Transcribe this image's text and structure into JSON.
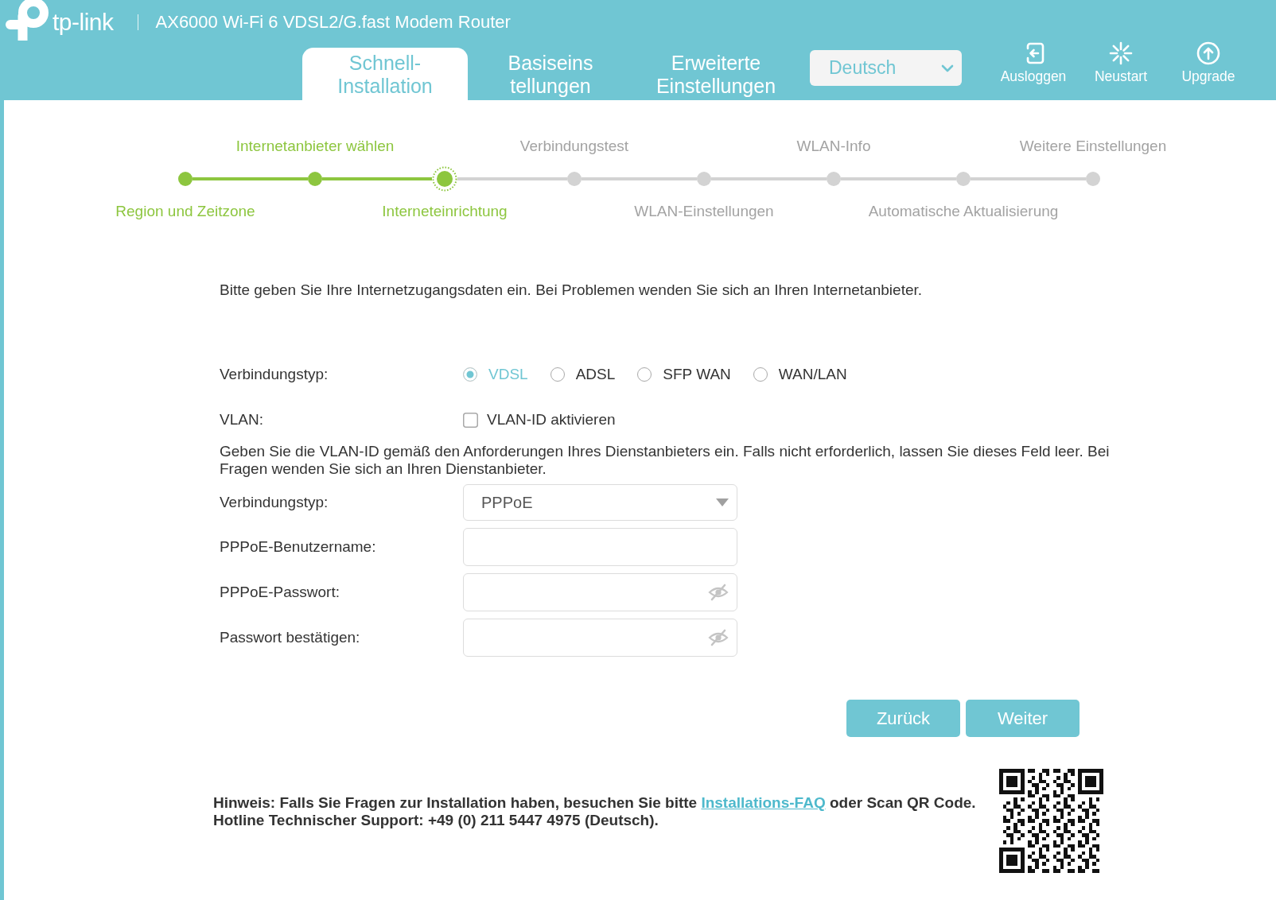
{
  "header": {
    "logo": "tp-link",
    "title": "AX6000 Wi-Fi 6 VDSL2/G.fast Modem Router",
    "tabs": [
      {
        "label": "Schnell-Installation",
        "selected": true
      },
      {
        "label": "Basiseins tellungen",
        "selected": false
      },
      {
        "label": "Erweiterte Einstellungen",
        "selected": false
      }
    ],
    "language": {
      "value": "Deutsch"
    },
    "actions": [
      {
        "kind": "logout",
        "label": "Ausloggen"
      },
      {
        "kind": "reboot",
        "label": "Neustart"
      },
      {
        "kind": "upgrade",
        "label": "Upgrade"
      }
    ]
  },
  "steps": [
    {
      "label": "Region und Zeitzone",
      "completed": true,
      "current": false
    },
    {
      "label": "Internetanbieter wählen",
      "completed": true,
      "current": false
    },
    {
      "label": "Interneteinrichtung",
      "completed": false,
      "current": true
    },
    {
      "label": "Verbindungstest",
      "completed": false,
      "current": false
    },
    {
      "label": "WLAN-Einstellungen",
      "completed": false,
      "current": false
    },
    {
      "label": "WLAN-Info",
      "completed": false,
      "current": false
    },
    {
      "label": "Automatische Aktualisierung",
      "completed": false,
      "current": false
    },
    {
      "label": "Weitere Einstellungen",
      "completed": false,
      "current": false
    }
  ],
  "intro": "Bitte geben Sie Ihre Internetzugangsdaten ein. Bei Problemen wenden Sie sich an Ihren Internetanbieter.",
  "form": {
    "connection_type": {
      "label": "Verbindungstyp:",
      "options": [
        {
          "label": "VDSL",
          "selected": true
        },
        {
          "label": "ADSL",
          "selected": false
        },
        {
          "label": "SFP WAN",
          "selected": false
        },
        {
          "label": "WAN/LAN",
          "selected": false
        }
      ]
    },
    "vlan": {
      "label": "VLAN:",
      "checkbox_label": "VLAN-ID aktivieren",
      "checked": false
    },
    "vlan_note": "Geben Sie die VLAN-ID gemäß den Anforderungen Ihres Dienstanbieters ein. Falls nicht erforderlich, lassen Sie dieses Feld leer. Bei Fragen wenden Sie sich an Ihren Dienstanbieter.",
    "fields": [
      {
        "kind": "select",
        "label": "Verbindungstyp:",
        "value": "PPPoE"
      },
      {
        "kind": "text",
        "label": "PPPoE-Benutzername:"
      },
      {
        "kind": "password",
        "label": "PPPoE-Passwort:"
      },
      {
        "kind": "password",
        "label": "Passwort bestätigen:"
      }
    ]
  },
  "buttons": [
    {
      "label": "Zurück"
    },
    {
      "label": "Weiter"
    }
  ],
  "footer": {
    "hint_before": "Hinweis: Falls Sie Fragen zur Installation haben, besuchen Sie bitte",
    "link": "Installations-FAQ",
    "hint_after": "oder Scan QR Code.",
    "hotline": "Hotline Technischer Support: +49 (0) 211 5447 4975 (Deutsch)."
  }
}
